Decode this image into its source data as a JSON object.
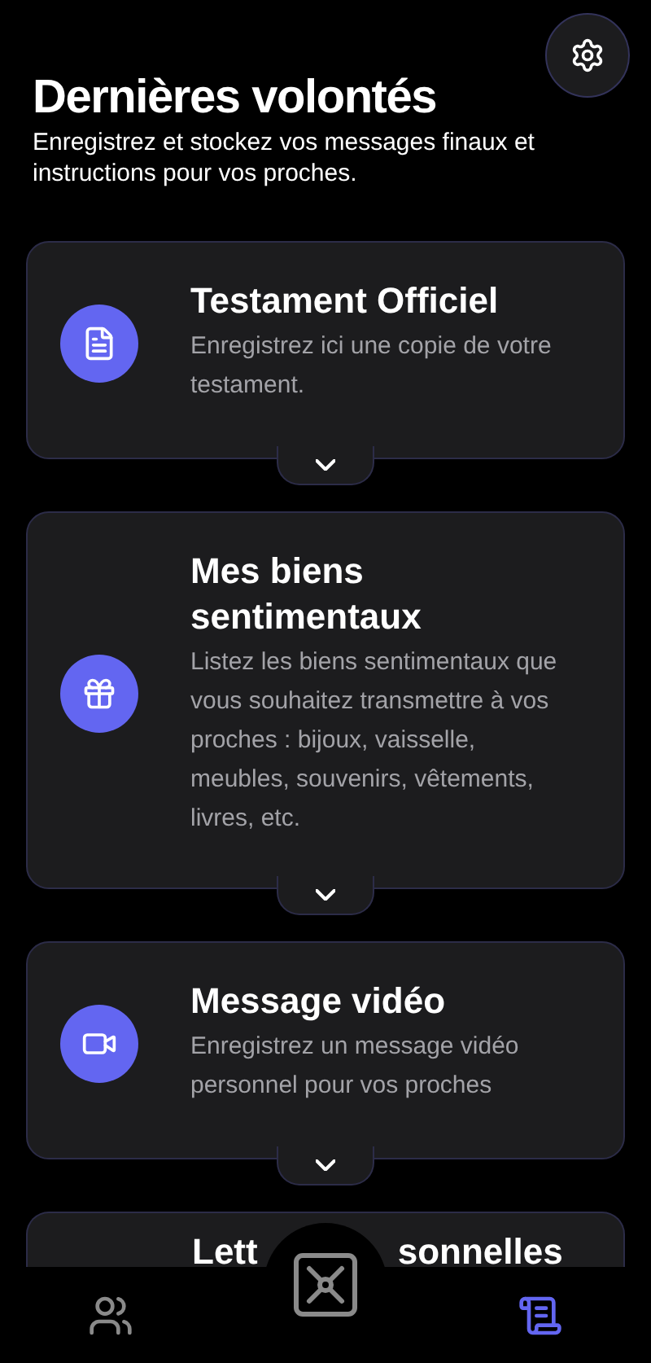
{
  "header": {
    "title": "Dernières volontés",
    "subtitle": "Enregistrez et stockez vos messages finaux et instructions pour vos proches."
  },
  "cards": [
    {
      "title": "Testament Officiel",
      "description": "Enregistrez ici une copie de votre testament.",
      "expanded": false
    },
    {
      "title": "Mes biens sentimentaux",
      "description": "Listez les biens sentimentaux que vous souhaitez transmettre à vos proches : bijoux, vaisselle, meubles, souvenirs, vêtements, livres, etc.",
      "expanded": false
    },
    {
      "title": "Message vidéo",
      "description": "Enregistrez un message vidéo personnel pour vos proches",
      "expanded": false
    }
  ],
  "partial_card": {
    "title_parts": [
      "Lett",
      "sonnelles"
    ]
  },
  "nav": [
    {
      "selected": false
    },
    {
      "selected": false
    },
    {
      "selected": true
    }
  ]
}
